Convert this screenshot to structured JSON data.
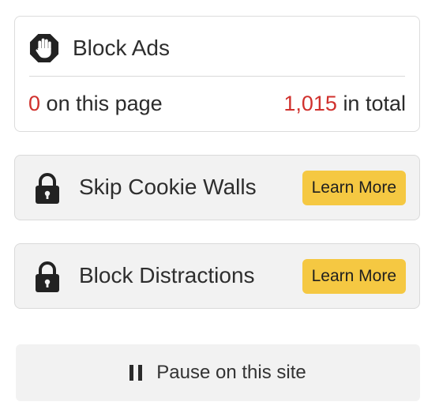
{
  "block_ads": {
    "title": "Block Ads",
    "page_count": "0",
    "page_label": "on this page",
    "total_count": "1,015",
    "total_label": "in total",
    "icon": "stop-hand-icon"
  },
  "features": [
    {
      "title": "Skip Cookie Walls",
      "button": "Learn More",
      "icon": "lock-icon"
    },
    {
      "title": "Block Distractions",
      "button": "Learn More",
      "icon": "lock-icon"
    }
  ],
  "pause": {
    "label": "Pause on this site",
    "icon": "pause-icon"
  },
  "colors": {
    "accent_red": "#d0312d",
    "button_yellow": "#f5c842",
    "panel_gray": "#f2f2f2"
  }
}
